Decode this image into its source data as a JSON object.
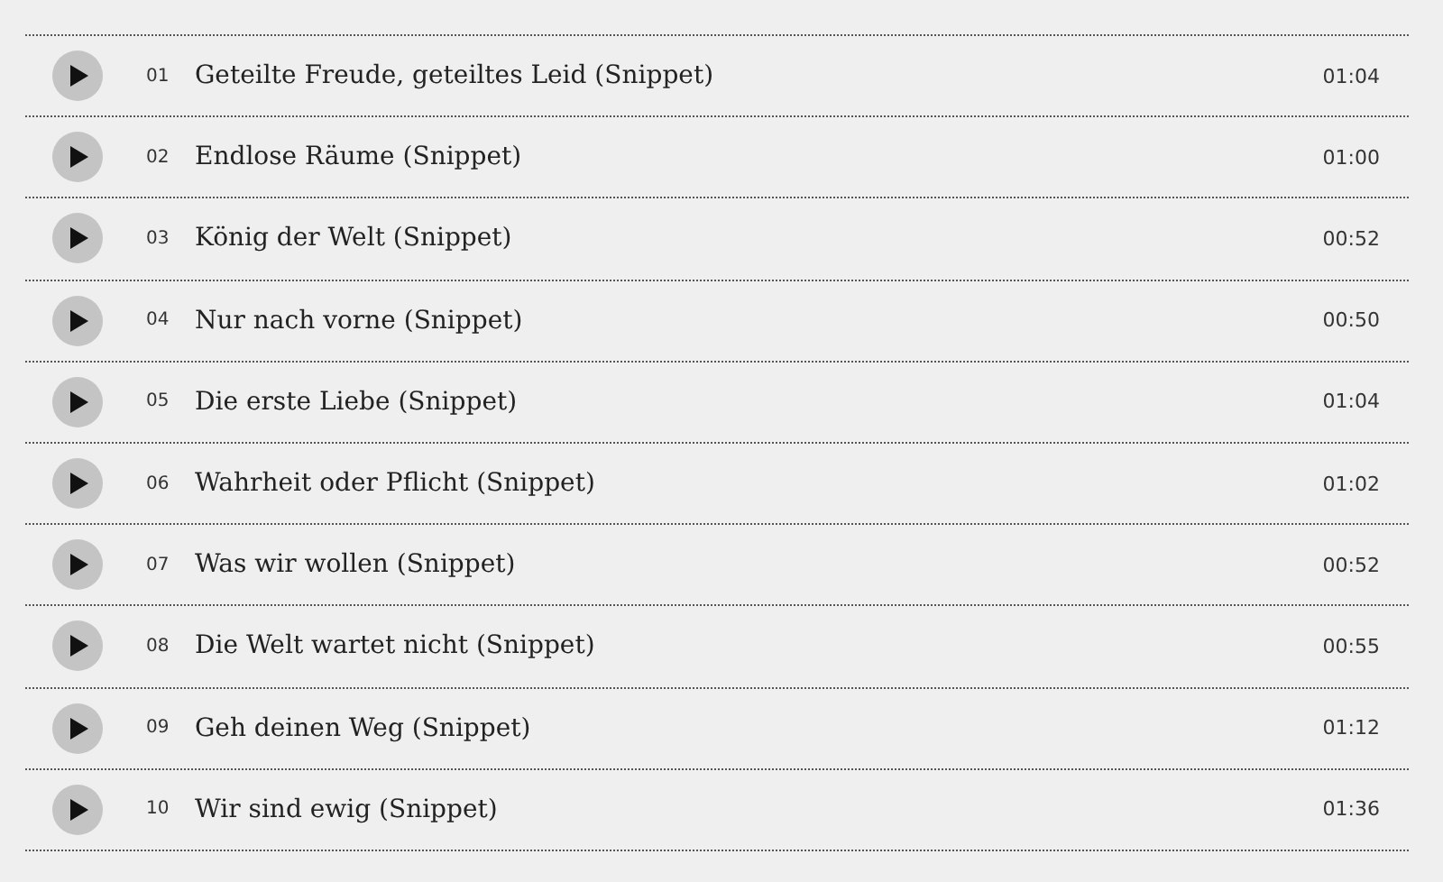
{
  "tracks": [
    {
      "number": "01",
      "title": "Geteilte Freude, geteiltes Leid (Snippet)",
      "duration": "01:04"
    },
    {
      "number": "02",
      "title": "Endlose Räume (Snippet)",
      "duration": "01:00"
    },
    {
      "number": "03",
      "title": "König der Welt (Snippet)",
      "duration": "00:52"
    },
    {
      "number": "04",
      "title": "Nur nach vorne (Snippet)",
      "duration": "00:50"
    },
    {
      "number": "05",
      "title": "Die erste Liebe (Snippet)",
      "duration": "01:04"
    },
    {
      "number": "06",
      "title": "Wahrheit oder Pflicht (Snippet)",
      "duration": "01:02"
    },
    {
      "number": "07",
      "title": "Was wir wollen (Snippet)",
      "duration": "00:52"
    },
    {
      "number": "08",
      "title": "Die Welt wartet nicht (Snippet)",
      "duration": "00:55"
    },
    {
      "number": "09",
      "title": "Geh deinen Weg (Snippet)",
      "duration": "01:12"
    },
    {
      "number": "10",
      "title": "Wir sind ewig (Snippet)",
      "duration": "01:36"
    }
  ]
}
